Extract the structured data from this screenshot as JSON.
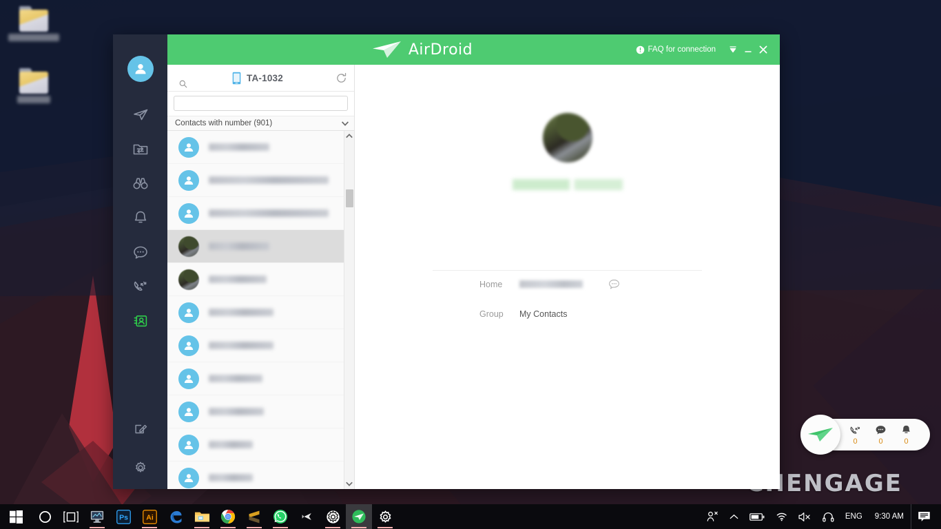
{
  "desktop": {
    "icons": [
      {
        "name": "desktop-folder-1",
        "label_blurred": true
      },
      {
        "name": "desktop-folder-2",
        "label_blurred": true
      }
    ],
    "watermark": "CHENGAGE"
  },
  "window": {
    "title_bar": {
      "brand": "AirDroid",
      "faq_label": "FAQ for connection",
      "info_icon": "info-icon",
      "collapse_icon": "collapse-to-tray-icon",
      "minimize_icon": "minimize-icon",
      "close_icon": "close-icon",
      "accent_color": "#4ecb71"
    },
    "nav_rail": {
      "avatar_icon": "user-avatar-icon",
      "items": [
        {
          "label": "Transfer",
          "icon": "paper-plane-icon",
          "active": false
        },
        {
          "label": "Files",
          "icon": "folder-transfer-icon",
          "active": false
        },
        {
          "label": "Mirror",
          "icon": "binoculars-icon",
          "active": false
        },
        {
          "label": "Notifications",
          "icon": "bell-icon",
          "active": false
        },
        {
          "label": "Messages",
          "icon": "chat-bubble-icon",
          "active": false
        },
        {
          "label": "Call Logs",
          "icon": "phone-calls-icon",
          "active": false
        },
        {
          "label": "Contacts",
          "icon": "contacts-card-icon",
          "active": true
        }
      ],
      "bottom_items": [
        {
          "label": "Feedback",
          "icon": "compose-icon"
        },
        {
          "label": "Settings",
          "icon": "gear-icon"
        }
      ],
      "active_color": "#2ecc4a"
    },
    "contacts_panel": {
      "device_name": "TA-1032",
      "device_icon": "phone-icon",
      "refresh_icon": "refresh-icon",
      "search": {
        "value": "",
        "placeholder": "",
        "icon": "search-icon"
      },
      "group_filter": {
        "label": "Contacts with number (901)",
        "chevron": "chevron-down-icon"
      },
      "scrollbar": {
        "up_icon": "chevron-up-icon",
        "down_icon": "chevron-down-icon"
      },
      "contacts": [
        {
          "name_blurred": true,
          "avatar": "default",
          "selected": false,
          "width": 88
        },
        {
          "name_blurred": true,
          "avatar": "default",
          "selected": false,
          "width": 174
        },
        {
          "name_blurred": true,
          "avatar": "default",
          "selected": false,
          "width": 174
        },
        {
          "name_blurred": true,
          "avatar": "photo",
          "selected": true,
          "width": 88
        },
        {
          "name_blurred": true,
          "avatar": "photo",
          "selected": false,
          "width": 84
        },
        {
          "name_blurred": true,
          "avatar": "default",
          "selected": false,
          "width": 94
        },
        {
          "name_blurred": true,
          "avatar": "default",
          "selected": false,
          "width": 94
        },
        {
          "name_blurred": true,
          "avatar": "default",
          "selected": false,
          "width": 78
        },
        {
          "name_blurred": true,
          "avatar": "default",
          "selected": false,
          "width": 80
        },
        {
          "name_blurred": true,
          "avatar": "default",
          "selected": false,
          "width": 64
        },
        {
          "name_blurred": true,
          "avatar": "default",
          "selected": false,
          "width": 64
        }
      ]
    },
    "detail": {
      "avatar": "contact-photo",
      "name_blurred": true,
      "rows": [
        {
          "label": "Home",
          "value_blurred": true,
          "action_icon": "message-bubble-icon"
        },
        {
          "label": "Group",
          "value": "My Contacts"
        }
      ]
    }
  },
  "float_widget": {
    "logo_icon": "airdroid-arrow-icon",
    "counters": [
      {
        "icon": "phone-calls-icon",
        "count": "0"
      },
      {
        "icon": "chat-bubble-icon",
        "count": "0"
      },
      {
        "icon": "bell-icon",
        "count": "0"
      }
    ]
  },
  "taskbar": {
    "apps": [
      {
        "name": "start-button",
        "icon": "windows-logo-icon"
      },
      {
        "name": "cortana-search",
        "icon": "circle-icon"
      },
      {
        "name": "task-view",
        "icon": "task-view-icon"
      },
      {
        "name": "monitor-app",
        "icon": "monitor-icon"
      },
      {
        "name": "photoshop",
        "icon": "ps-icon",
        "label": "Ps"
      },
      {
        "name": "illustrator",
        "icon": "ai-icon",
        "label": "Ai"
      },
      {
        "name": "edge",
        "icon": "edge-icon"
      },
      {
        "name": "file-explorer",
        "icon": "folder-icon"
      },
      {
        "name": "chrome",
        "icon": "chrome-icon"
      },
      {
        "name": "sublime-text",
        "icon": "sublime-icon"
      },
      {
        "name": "whatsapp",
        "icon": "whatsapp-icon"
      },
      {
        "name": "unity",
        "icon": "unity-icon"
      },
      {
        "name": "settings-app",
        "icon": "gear-icon"
      },
      {
        "name": "airdroid",
        "icon": "airdroid-arrow-icon"
      },
      {
        "name": "control-panel",
        "icon": "gear-icon"
      }
    ],
    "tray": {
      "people": "people-icon",
      "show_hidden": "chevron-up-icon",
      "battery": "battery-icon",
      "wifi": "wifi-icon",
      "volume": "volume-muted-icon",
      "headphones": "headphones-icon",
      "language": "ENG",
      "clock": "9:30 AM",
      "notifications": "action-center-icon"
    }
  }
}
